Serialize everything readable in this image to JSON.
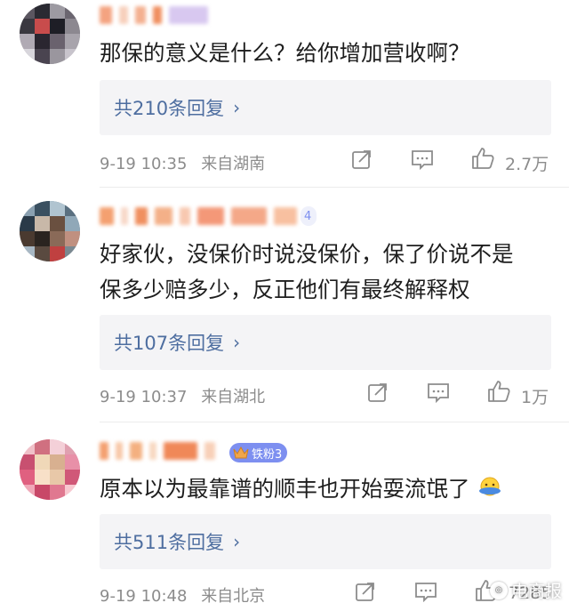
{
  "comments": [
    {
      "text": "那保的意义是什么？给你增加营收啊？",
      "replies": "共210条回复",
      "time": "9-19 10:35",
      "location": "来自湖南",
      "likes": "2.7万"
    },
    {
      "badge": "4",
      "text_line1": "好家伙，没保价时说没保价，保了价说不是",
      "text_line2": "保多少赔多少，反正他们有最终解释权",
      "replies": "共107条回复",
      "time": "9-19 10:37",
      "location": "来自湖北",
      "likes": "1万"
    },
    {
      "badge": "铁粉3",
      "text": "原本以为最靠谱的顺丰也开始耍流氓了",
      "replies": "共511条回复",
      "time": "9-19 10:48",
      "location": "来自北京",
      "likes": "7285"
    }
  ],
  "icons": {
    "share": "share-icon",
    "comment": "comment-icon",
    "like": "thumbs-up-icon",
    "reply_chevron": "chevron-right-icon",
    "emoji": "facepalm-emoji-icon"
  },
  "colors": {
    "link": "#4e6ea0",
    "meta": "#8c8c8c",
    "reply_bg": "#f4f4f6",
    "badge_gold": "#f0a64a",
    "badge_blue": "#7d8ff0"
  },
  "watermark": {
    "text": "电商报"
  }
}
